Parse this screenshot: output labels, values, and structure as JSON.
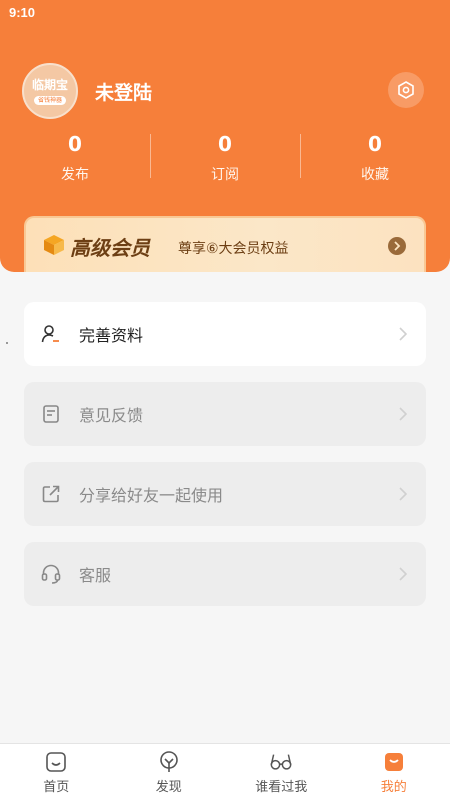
{
  "status_bar": {
    "time": "9:10"
  },
  "header": {
    "avatar": {
      "title": "临期宝",
      "subtitle": "省钱神器"
    },
    "username": "未登陆",
    "settings_icon": "hexagon-settings-icon"
  },
  "stats": [
    {
      "value": "0",
      "label": "发布"
    },
    {
      "value": "0",
      "label": "订阅"
    },
    {
      "value": "0",
      "label": "收藏"
    }
  ],
  "vip": {
    "title": "高级会员",
    "description": "尊享⑥大会员权益",
    "icon": "gold-box-icon"
  },
  "menu": [
    {
      "label": "完善资料",
      "icon": "user-edit-icon",
      "state": "active"
    },
    {
      "label": "意见反馈",
      "icon": "feedback-doc-icon",
      "state": "disabled"
    },
    {
      "label": "分享给好友一起使用",
      "icon": "share-icon",
      "state": "disabled"
    },
    {
      "label": "客服",
      "icon": "headset-icon",
      "state": "disabled"
    }
  ],
  "tabs": [
    {
      "label": "首页",
      "icon": "home-icon"
    },
    {
      "label": "发现",
      "icon": "discover-icon"
    },
    {
      "label": "谁看过我",
      "icon": "glasses-icon"
    },
    {
      "label": "我的",
      "icon": "bag-icon",
      "active": true
    }
  ],
  "colors": {
    "primary": "#f67f3a",
    "vip_text": "#6d3f14",
    "background": "#f6f6f6"
  }
}
